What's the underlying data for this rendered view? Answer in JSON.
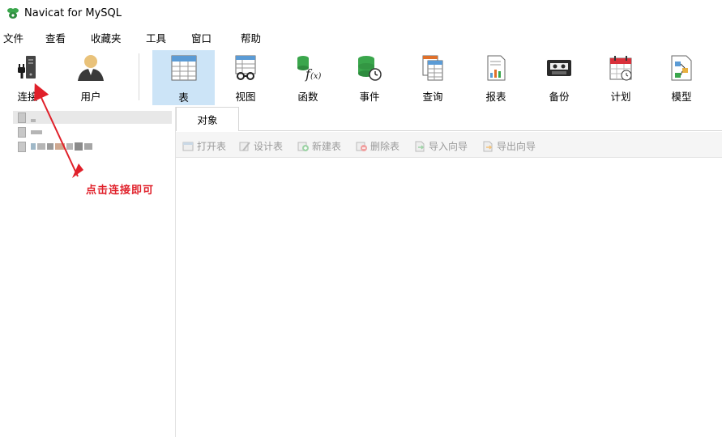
{
  "window": {
    "title": "Navicat for MySQL"
  },
  "menu": {
    "items": [
      "文件",
      "查看",
      "收藏夹",
      "工具",
      "窗口",
      "帮助"
    ]
  },
  "toolbar": {
    "buttons": [
      {
        "label": "连接",
        "icon": "connection-icon"
      },
      {
        "label": "用户",
        "icon": "user-icon"
      },
      {
        "label": "表",
        "icon": "table-icon",
        "active": true
      },
      {
        "label": "视图",
        "icon": "view-icon"
      },
      {
        "label": "函数",
        "icon": "function-icon"
      },
      {
        "label": "事件",
        "icon": "event-icon"
      },
      {
        "label": "查询",
        "icon": "query-icon"
      },
      {
        "label": "报表",
        "icon": "report-icon"
      },
      {
        "label": "备份",
        "icon": "backup-icon"
      },
      {
        "label": "计划",
        "icon": "schedule-icon"
      },
      {
        "label": "模型",
        "icon": "model-icon"
      }
    ]
  },
  "tabs": {
    "objects_label": "对象"
  },
  "object_toolbar": {
    "open_table": "打开表",
    "design_table": "设计表",
    "new_table": "新建表",
    "delete_table": "删除表",
    "import_wizard": "导入向导",
    "export_wizard": "导出向导"
  },
  "annotation": {
    "text": "点击连接即可",
    "color": "#e0202a"
  },
  "colors": {
    "active_tab": "#cce4f7",
    "accent_green": "#3aa64c",
    "accent_red": "#e0202a"
  }
}
